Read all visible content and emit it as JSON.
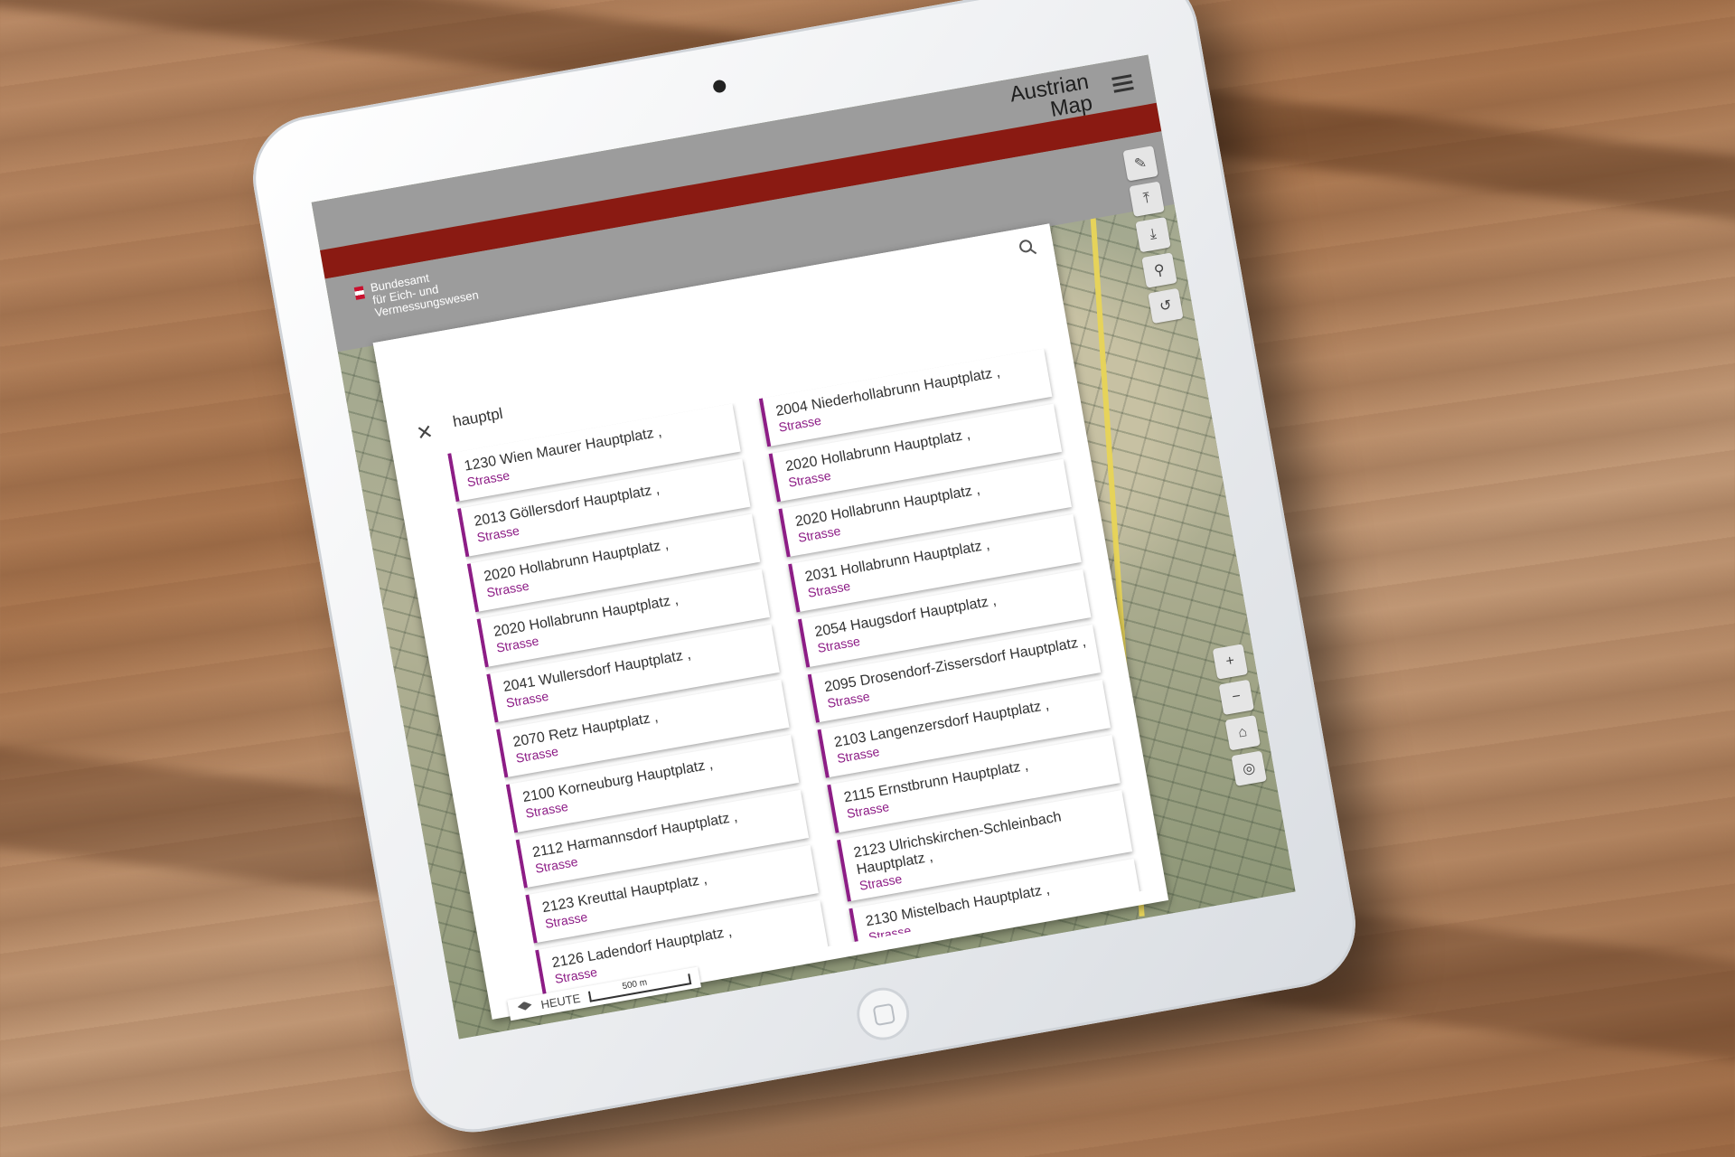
{
  "header": {
    "app_title": "Austrian Map",
    "agency_lines": [
      "Bundesamt",
      "für Eich- und",
      "Vermessungswesen"
    ]
  },
  "search": {
    "query": "hauptpl"
  },
  "results": {
    "left": [
      {
        "title": "1230 Wien Maurer Hauptplatz ,",
        "type": "Strasse"
      },
      {
        "title": "2013 Göllersdorf Hauptplatz ,",
        "type": "Strasse"
      },
      {
        "title": "2020 Hollabrunn Hauptplatz ,",
        "type": "Strasse"
      },
      {
        "title": "2020 Hollabrunn Hauptplatz ,",
        "type": "Strasse"
      },
      {
        "title": "2041 Wullersdorf Hauptplatz ,",
        "type": "Strasse"
      },
      {
        "title": "2070 Retz Hauptplatz ,",
        "type": "Strasse"
      },
      {
        "title": "2100 Korneuburg Hauptplatz ,",
        "type": "Strasse"
      },
      {
        "title": "2112 Harmannsdorf Hauptplatz ,",
        "type": "Strasse"
      },
      {
        "title": "2123 Kreuttal Hauptplatz ,",
        "type": "Strasse"
      },
      {
        "title": "2126 Ladendorf Hauptplatz ,",
        "type": "Strasse"
      }
    ],
    "right": [
      {
        "title": "2004 Niederhollabrunn Hauptplatz ,",
        "type": "Strasse"
      },
      {
        "title": "2020 Hollabrunn Hauptplatz ,",
        "type": "Strasse"
      },
      {
        "title": "2020 Hollabrunn Hauptplatz ,",
        "type": "Strasse"
      },
      {
        "title": "2031 Hollabrunn Hauptplatz ,",
        "type": "Strasse"
      },
      {
        "title": "2054 Haugsdorf Hauptplatz ,",
        "type": "Strasse"
      },
      {
        "title": "2095 Drosendorf-Zissersdorf Hauptplatz ,",
        "type": "Strasse"
      },
      {
        "title": "2103 Langenzersdorf Hauptplatz ,",
        "type": "Strasse"
      },
      {
        "title": "2115 Ernstbrunn Hauptplatz ,",
        "type": "Strasse"
      },
      {
        "title": "2123 Ulrichskirchen-Schleinbach Hauptplatz ,",
        "type": "Strasse"
      },
      {
        "title": "2130 Mistelbach Hauptplatz ,",
        "type": "Strasse"
      }
    ]
  },
  "footer": {
    "layer_label": "HEUTE",
    "scale_label": "500 m"
  },
  "colors": {
    "accent": "#8d1d86",
    "header_red": "#8a1a12"
  }
}
